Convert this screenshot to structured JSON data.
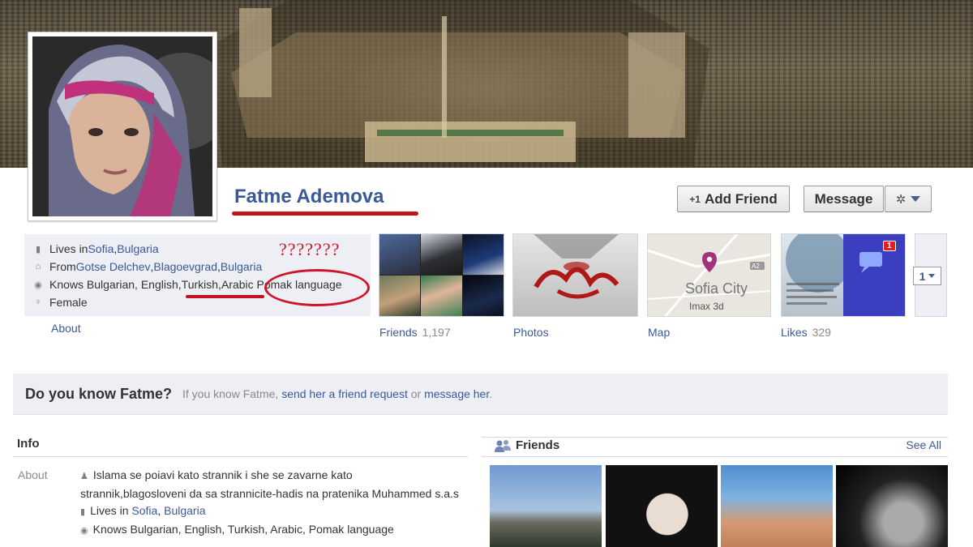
{
  "profile": {
    "name": "Fatme Ademova"
  },
  "actions": {
    "add_friend_label": "Add Friend",
    "add_friend_icon": "+1",
    "message_label": "Message"
  },
  "intro": {
    "lives_prefix": "Lives in ",
    "lives_city": "Sofia",
    "lives_sep": ", ",
    "lives_country": "Bulgaria",
    "from_prefix": "From ",
    "from_city": "Gotse Delchev",
    "from_sep": ", ",
    "from_region": "Blagoevgrad",
    "from_sep2": ", ",
    "from_country": "Bulgaria",
    "knows_prefix": "Knows Bulgarian, English, ",
    "knows_turkish": "Turkish",
    "knows_sep": ", ",
    "knows_arabic": "Arabic",
    "knows_pomak": "Pomak language",
    "gender": "Female",
    "about_link": "About"
  },
  "annotation": {
    "question_marks": "???????"
  },
  "thumbnails": {
    "friends_label": "Friends",
    "friends_count": "1,197",
    "photos_label": "Photos",
    "map_label": "Map",
    "map_city": "Sofia City",
    "map_place": "Imax 3d",
    "map_road": "A2",
    "likes_label": "Likes",
    "likes_count": "329",
    "likes_badge": "1",
    "more_count": "1"
  },
  "banner": {
    "title": "Do you know Fatme?",
    "text_prefix": "If you know Fatme, ",
    "link1": "send her a friend request",
    "text_mid": " or ",
    "link2": "message her",
    "text_end": "."
  },
  "info": {
    "header": "Info",
    "about_label": "About",
    "about_text": "Islama se poiavi kato strannik i she se zavarne kato strannik,blagosloveni da sa strannicite-hadis na pratenika Muhammed s.a.s",
    "lives_prefix": "Lives in ",
    "lives_city": "Sofia",
    "lives_sep": ", ",
    "lives_country": "Bulgaria",
    "knows": "Knows Bulgarian, English, Turkish, Arabic, Pomak language"
  },
  "friends": {
    "header": "Friends",
    "see_all": "See All"
  },
  "colors": {
    "link": "#3b5998",
    "annotation_red": "#d0142c",
    "panel_bg": "#edeff4"
  },
  "icons": {
    "lives": "building-icon",
    "from": "house-icon",
    "knows": "globe-icon",
    "gender": "gender-icon",
    "friends": "friends-icon",
    "settings": "gear-icon"
  }
}
